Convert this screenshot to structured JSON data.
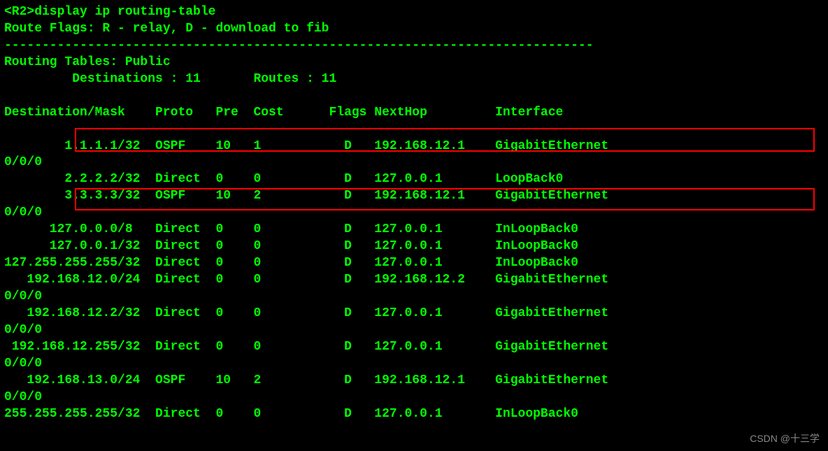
{
  "prompt": "<R2>display ip routing-table",
  "flags_line": "Route Flags: R - relay, D - download to fib",
  "divider": "------------------------------------------------------------------------------",
  "tables_header": "Routing Tables: Public",
  "counts_line": "         Destinations : 11       Routes : 11",
  "columns_line": "Destination/Mask    Proto   Pre  Cost      Flags NextHop         Interface",
  "rows": [
    {
      "wrap": "0/0/0",
      "line": "        1.1.1.1/32  OSPF    10   1           D   192.168.12.1    GigabitEthernet"
    },
    {
      "wrap": "",
      "line": "        2.2.2.2/32  Direct  0    0           D   127.0.0.1       LoopBack0"
    },
    {
      "wrap": "0/0/0",
      "line": "        3.3.3.3/32  OSPF    10   2           D   192.168.12.1    GigabitEthernet"
    },
    {
      "wrap": "",
      "line": "      127.0.0.0/8   Direct  0    0           D   127.0.0.1       InLoopBack0"
    },
    {
      "wrap": "",
      "line": "      127.0.0.1/32  Direct  0    0           D   127.0.0.1       InLoopBack0"
    },
    {
      "wrap": "",
      "line": "127.255.255.255/32  Direct  0    0           D   127.0.0.1       InLoopBack0"
    },
    {
      "wrap": "0/0/0",
      "line": "   192.168.12.0/24  Direct  0    0           D   192.168.12.2    GigabitEthernet"
    },
    {
      "wrap": "0/0/0",
      "line": "   192.168.12.2/32  Direct  0    0           D   127.0.0.1       GigabitEthernet"
    },
    {
      "wrap": "0/0/0",
      "line": " 192.168.12.255/32  Direct  0    0           D   127.0.0.1       GigabitEthernet"
    },
    {
      "wrap": "0/0/0",
      "line": "   192.168.13.0/24  OSPF    10   2           D   192.168.12.1    GigabitEthernet"
    },
    {
      "wrap": "",
      "line": "255.255.255.255/32  Direct  0    0           D   127.0.0.1       InLoopBack0"
    }
  ],
  "watermark": "CSDN @十三学"
}
